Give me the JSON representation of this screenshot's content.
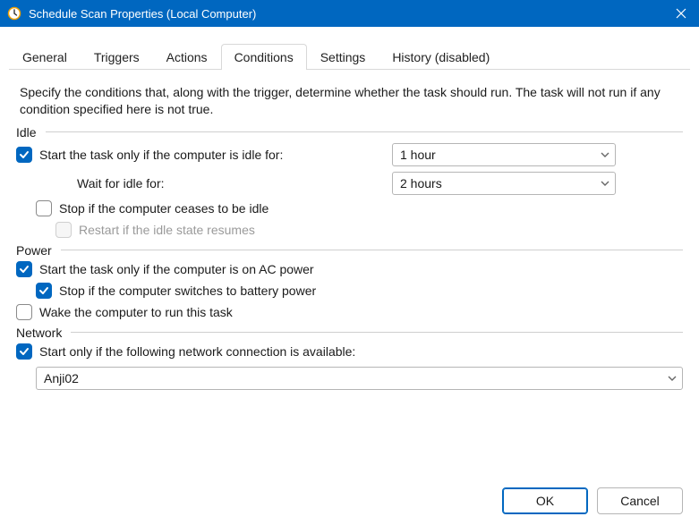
{
  "window": {
    "title": "Schedule Scan Properties (Local Computer)"
  },
  "tabs": {
    "general": "General",
    "triggers": "Triggers",
    "actions": "Actions",
    "conditions": "Conditions",
    "settings": "Settings",
    "history": "History (disabled)"
  },
  "conditions": {
    "description": "Specify the conditions that, along with the trigger, determine whether the task should run.  The task will not run  if any condition specified here is not true.",
    "idle": {
      "header": "Idle",
      "start_if_idle_label": "Start the task only if the computer is idle for:",
      "idle_duration": "1 hour",
      "wait_label": "Wait for idle for:",
      "wait_duration": "2 hours",
      "stop_if_ceases_label": "Stop if the computer ceases to be idle",
      "restart_label": "Restart if the idle state resumes"
    },
    "power": {
      "header": "Power",
      "on_ac_label": "Start the task only if the computer is on AC power",
      "stop_battery_label": "Stop if the computer switches to battery power",
      "wake_label": "Wake the computer to run this task"
    },
    "network": {
      "header": "Network",
      "only_if_net_label": "Start only if the following network connection is available:",
      "connection": "Anji02"
    }
  },
  "buttons": {
    "ok": "OK",
    "cancel": "Cancel"
  }
}
